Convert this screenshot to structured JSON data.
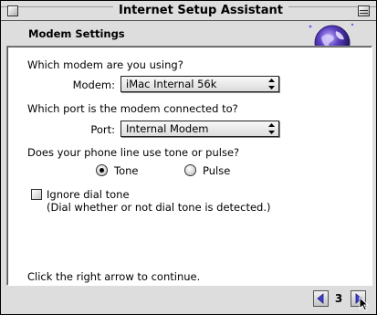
{
  "window": {
    "title": "Internet Setup Assistant"
  },
  "header": {
    "section_title": "Modem Settings"
  },
  "modem": {
    "question": "Which modem are you using?",
    "label": "Modem:",
    "value": "iMac Internal 56k"
  },
  "port": {
    "question": "Which port is the modem connected to?",
    "label": "Port:",
    "value": "Internal Modem"
  },
  "dial": {
    "question": "Does your phone line use tone or pulse?",
    "tone_label": "Tone",
    "pulse_label": "Pulse",
    "selected": "Tone"
  },
  "ignore_dial_tone": {
    "label": "Ignore dial tone",
    "note": "(Dial whether or not dial tone is detected.)",
    "checked": false
  },
  "instructions": "Click the right arrow to continue.",
  "footer": {
    "page_number": "3"
  }
}
